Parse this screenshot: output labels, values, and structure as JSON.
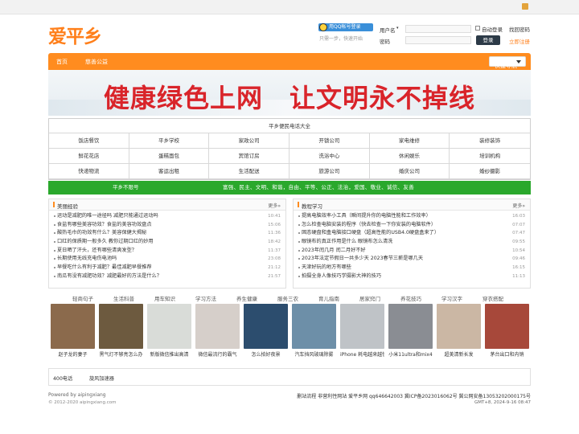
{
  "site": {
    "logo": "爱平乡"
  },
  "header": {
    "qq_button": "用QQ帐号登录",
    "qq_sub": "只需一步，快速开始",
    "username_label": "用户名",
    "password_label": "密码",
    "auto_login": "自动登录",
    "find_password": "找回密码",
    "login_button": "登录",
    "register": "立即注册"
  },
  "nav": {
    "items": [
      "首页",
      "慈善公益"
    ],
    "quick": "快捷导航"
  },
  "banner": {
    "slogan": "健康绿色上网　让文明永不掉线"
  },
  "phone": {
    "title": "平乡便民电话大全",
    "cells": [
      "饭店餐饮",
      "平乡学校",
      "家政公司",
      "开锁公司",
      "家电维修",
      "装修装饰",
      "鲜花花店",
      "蛋糕面包",
      "宾馆订房",
      "洗浴中心",
      "休闲娱乐",
      "培训机构",
      "快递物流",
      "客运出租",
      "生活配送",
      "旅游公司",
      "婚庆公司",
      "婚纱摄影"
    ]
  },
  "green": {
    "left": "平乡不限号",
    "right": "富强、民主、文明、和谐，自由、平等、公正、法治，爱国、敬业、诚信、友善"
  },
  "left_col": {
    "title": "美丽经验",
    "more": "更多»",
    "items": [
      {
        "t": "运动是减肥的唯一途径吗 减肥只能通过运动吗",
        "d": "10:41"
      },
      {
        "t": "食盐有哪些美容功效？食盐的美容功效盘点",
        "d": "15:06"
      },
      {
        "t": "酸热毛巾的功效有什么？美容保健大揭秘",
        "d": "11:36"
      },
      {
        "t": "口红的保质期一般多久 教你过期口红的妙用",
        "d": "18:42"
      },
      {
        "t": "夏日晒了汗头，还有哪些清爽发型？",
        "d": "11:37"
      },
      {
        "t": "长期使用无线充电伤电池吗",
        "d": "23:08"
      },
      {
        "t": "早餐吃什么有利于减肥？最佳减肥早餐推荐",
        "d": "21:12"
      },
      {
        "t": "南瓜有没有减肥功效？减肥最好的方法是什么？",
        "d": "21:57"
      }
    ]
  },
  "right_col": {
    "title": "教程学习",
    "more": "更多»",
    "items": [
      {
        "t": "提高电脑效率小工具（瞬间提升你的电脑性能和工作效率）",
        "d": "16:03"
      },
      {
        "t": "怎么检查电脑安装的程序（快去检查一下你安装的电脑软件）",
        "d": "07:07"
      },
      {
        "t": "固态硬盘和盒电脑接口硬盘（超高性能的USB4.0硬盘盒来了）",
        "d": "07:47"
      },
      {
        "t": "眼镜布的真正作用是什么 眼镜布怎么清洗",
        "d": "09:55"
      },
      {
        "t": "2023年闰几月 闰二月好不好",
        "d": "10:54"
      },
      {
        "t": "2023年法定节假日一共多少天 2023春节三薪是哪几天",
        "d": "09:46"
      },
      {
        "t": "天津好玩的地方有哪些",
        "d": "16:15"
      },
      {
        "t": "拍摄全身人像技巧学摄影大神的技巧",
        "d": "11:13"
      }
    ]
  },
  "tabs": [
    "轻商句子",
    "生活科普",
    "用车知识",
    "学习方法",
    "养生健康",
    "服务三农",
    "育儿指南",
    "居家窍门",
    "养花技巧",
    "学习汉字",
    "穿衣搭配"
  ],
  "pics": [
    {
      "cap": "赵子龙的妻子",
      "color": "#8b6a4c"
    },
    {
      "cap": "黑气灯不够亮怎么办",
      "color": "#6d5a3f"
    },
    {
      "cap": "新版微信推出高清",
      "color": "#d9dcd8"
    },
    {
      "cap": "微信最流行的霸气",
      "color": "#d6cfca"
    },
    {
      "cap": "怎么拍好夜景",
      "color": "#2c4d6e"
    },
    {
      "cap": "汽车挡风玻璃除雾",
      "color": "#6d8fa8"
    },
    {
      "cap": "iPhone 耗电越来越快",
      "color": "#bfc3c7"
    },
    {
      "cap": "小米11ultra和mix4",
      "color": "#8a8d93"
    },
    {
      "cap": "超美清新长发",
      "color": "#cbb7a4"
    },
    {
      "cap": "茅台出口和内销",
      "color": "#a7483a"
    }
  ],
  "links": [
    "400电话",
    "旋风加速器"
  ],
  "footer": {
    "powered": "Powered by aipingxiang",
    "copy": "© 2012-2020 aipingxiang.com",
    "right1": "删站流程  非营利性网站  爱平乡网 qq646642003  冀ICP备2023016062号 冀公网安备13053202000175号",
    "right2": "GMT+8, 2024-9-16 08:47"
  },
  "colors": {
    "orange": "#ff8c1f",
    "green": "#2aa82c",
    "red": "#d9242a"
  }
}
